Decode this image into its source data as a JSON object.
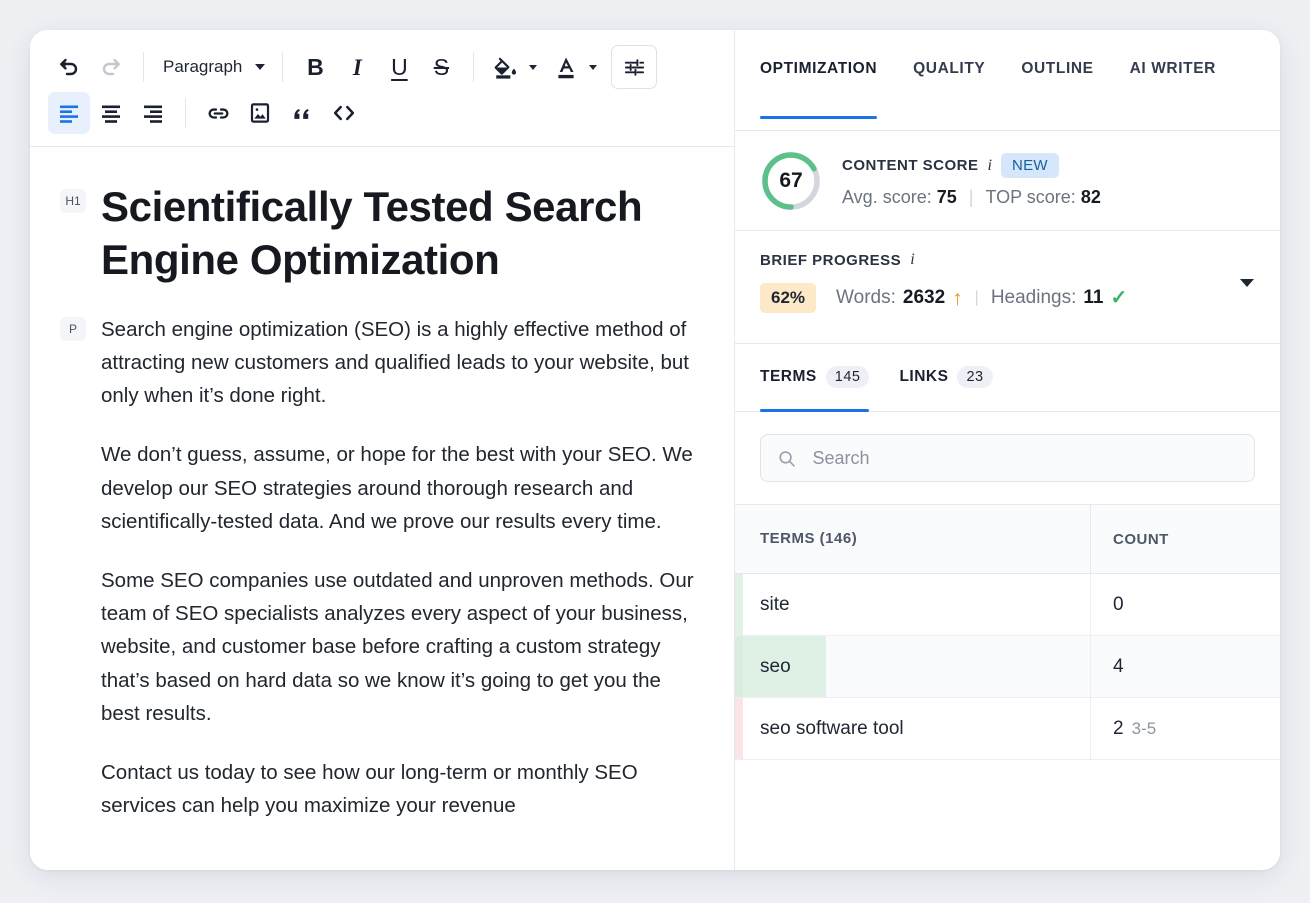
{
  "editor": {
    "toolbar": {
      "undo_label": "Undo",
      "redo_label": "Redo",
      "block_format": "Paragraph",
      "bold_label": "B",
      "italic_label": "I",
      "underline_label": "U",
      "strike_label": "S",
      "fill_color_label": "Fill color",
      "text_color_label": "Text color",
      "settings_label": "Formatting options",
      "align_left_label": "Align left",
      "align_center_label": "Align center",
      "align_right_label": "Align right",
      "link_label": "Insert link",
      "image_label": "Insert image",
      "quote_label": "Block quote",
      "code_label": "Code block"
    },
    "document": {
      "h1_tag": "H1",
      "p_tag": "P",
      "title": "Scientifically Tested Search Engine Optimization",
      "paragraphs": [
        "Search engine optimization (SEO) is a highly effective method of attracting new customers and qualified leads to your website, but only when it’s done right.",
        "We don’t guess, assume, or hope for the best with your SEO. We develop our SEO strategies around thorough research and scientifically-tested data. And we prove our results every time.",
        "Some SEO companies use outdated and unproven methods. Our team of SEO specialists analyzes every aspect of your business, website, and customer base before crafting a custom strategy that’s based on hard data so we know it’s going to get you the best results.",
        "Contact us today to see how our long-term or monthly SEO services can help you maximize your revenue"
      ]
    }
  },
  "panel": {
    "tabs": [
      {
        "label": "OPTIMIZATION",
        "active": true
      },
      {
        "label": "QUALITY",
        "active": false
      },
      {
        "label": "OUTLINE",
        "active": false
      },
      {
        "label": "AI WRITER",
        "active": false
      }
    ],
    "content_score": {
      "label": "CONTENT SCORE",
      "info_icon": "i",
      "badge": "NEW",
      "value": "67",
      "value_number": 67,
      "avg_label": "Avg. score:",
      "avg_value": "75",
      "top_label": "TOP score:",
      "top_value": "82",
      "ring_color": "#5dc08a",
      "ring_track_color": "#d3d6dd"
    },
    "brief_progress": {
      "label": "BRIEF PROGRESS",
      "info_icon": "i",
      "percent": "62%",
      "words_label": "Words:",
      "words_value": "2632",
      "words_status_icon": "↑",
      "headings_label": "Headings:",
      "headings_value": "11",
      "headings_status_icon": "✓",
      "pill_color": "#fde8c8",
      "arrow_color": "#f0930f",
      "check_color": "#34b463"
    },
    "sub_tabs": [
      {
        "label": "TERMS",
        "count": "145",
        "active": true
      },
      {
        "label": "LINKS",
        "count": "23",
        "active": false
      }
    ],
    "search": {
      "placeholder": "Search",
      "value": "",
      "icon": "search-icon"
    },
    "terms_table": {
      "columns": [
        "TERMS (146)",
        "COUNT"
      ],
      "rows": [
        {
          "term": "site",
          "count": "0",
          "range": "",
          "stripe": "#dff2e4",
          "highlight": "",
          "shaded": false
        },
        {
          "term": "seo",
          "count": "4",
          "range": "",
          "stripe": "#d9eddf",
          "highlight": "#dff0e5",
          "shaded": true
        },
        {
          "term": "seo software tool",
          "count": "2",
          "range": "3-5",
          "stripe": "#fbe4e6",
          "highlight": "",
          "shaded": false
        }
      ]
    }
  }
}
